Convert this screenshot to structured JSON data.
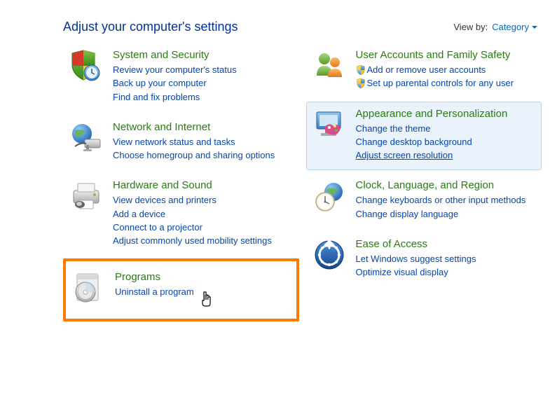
{
  "header": {
    "title": "Adjust your computer's settings",
    "viewby_label": "View by:",
    "viewby_value": "Category"
  },
  "left": [
    {
      "title": "System and Security",
      "icon": "shield-clock",
      "links": [
        {
          "text": "Review your computer's status"
        },
        {
          "text": "Back up your computer"
        },
        {
          "text": "Find and fix problems"
        }
      ]
    },
    {
      "title": "Network and Internet",
      "icon": "globe-network",
      "links": [
        {
          "text": "View network status and tasks"
        },
        {
          "text": "Choose homegroup and sharing options"
        }
      ]
    },
    {
      "title": "Hardware and Sound",
      "icon": "printer",
      "links": [
        {
          "text": "View devices and printers"
        },
        {
          "text": "Add a device"
        },
        {
          "text": "Connect to a projector"
        },
        {
          "text": "Adjust commonly used mobility settings"
        }
      ]
    },
    {
      "title": "Programs",
      "icon": "programs-disc",
      "highlight": true,
      "links": [
        {
          "text": "Uninstall a program"
        }
      ]
    }
  ],
  "right": [
    {
      "title": "User Accounts and Family Safety",
      "icon": "users",
      "links": [
        {
          "text": "Add or remove user accounts",
          "shield": true
        },
        {
          "text": "Set up parental controls for any user",
          "shield": true
        }
      ]
    },
    {
      "title": "Appearance and Personalization",
      "icon": "appearance",
      "hover": true,
      "links": [
        {
          "text": "Change the theme"
        },
        {
          "text": "Change desktop background"
        },
        {
          "text": "Adjust screen resolution",
          "underline": true
        }
      ]
    },
    {
      "title": "Clock, Language, and Region",
      "icon": "clock-globe",
      "links": [
        {
          "text": "Change keyboards or other input methods"
        },
        {
          "text": "Change display language"
        }
      ]
    },
    {
      "title": "Ease of Access",
      "icon": "ease-access",
      "links": [
        {
          "text": "Let Windows suggest settings"
        },
        {
          "text": "Optimize visual display"
        }
      ]
    }
  ]
}
